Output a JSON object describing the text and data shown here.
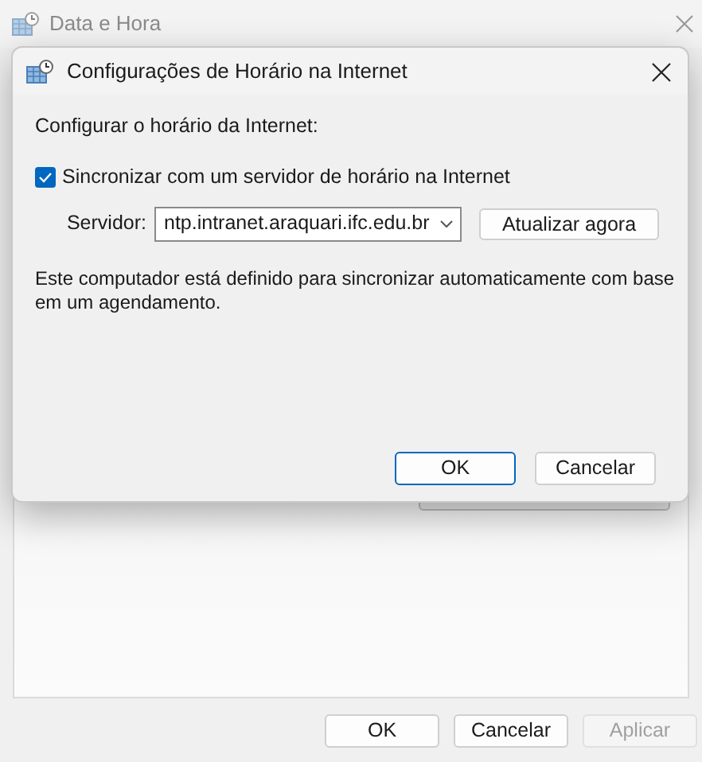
{
  "background_window": {
    "title": "Data e Hora",
    "buttons": [
      {
        "label": "OK",
        "disabled": false
      },
      {
        "label": "Cancelar",
        "disabled": false
      },
      {
        "label": "Aplicar",
        "disabled": true
      }
    ]
  },
  "dialog": {
    "title": "Configurações de Horário na Internet",
    "heading": "Configurar o horário da Internet:",
    "sync_checkbox": {
      "label": "Sincronizar com um servidor de horário na Internet",
      "checked": true
    },
    "server": {
      "label": "Servidor:",
      "value": "ntp.intranet.araquari.ifc.edu.br"
    },
    "update_button": "Atualizar agora",
    "description": "Este computador está definido para sincronizar automaticamente com base em um agendamento.",
    "buttons": [
      {
        "label": "OK",
        "default": true
      },
      {
        "label": "Cancelar",
        "default": false
      }
    ]
  }
}
